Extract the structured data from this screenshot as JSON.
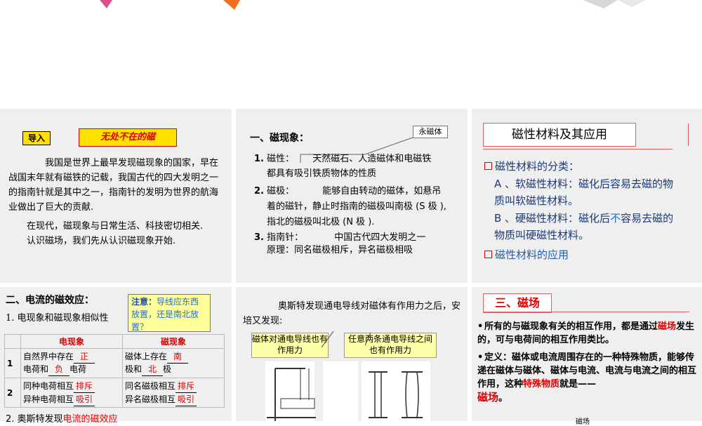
{
  "panel1": {
    "tag": "导入",
    "title": "无处不在的磁",
    "para1": "我国是世界上最早发现磁现象的国家，早在战国末年就有磁铁的记载，我国古代的四大发明之一的指南针就是其中之一，指南针的发明为世界的航海业做出了巨大的贡献.",
    "para2": "在现代，磁现象与日常生活、科技密切相关.",
    "para3": "认识磁场，我们先从认识磁现象开始."
  },
  "panel2": {
    "heading": "一、磁现象：",
    "callout": "永磁体",
    "item1_num": "1.",
    "item1_label": "磁性：",
    "item1_text": "天然磁石、人造磁体和电磁铁",
    "item1_cont": "都具有吸引铁质物体的性质",
    "item2_num": "2.",
    "item2_label": "磁极：",
    "item2_text": "能够自由转动的磁体，如悬吊",
    "item2_cont1": "着的磁针，静止时指南的磁极叫南极 (S 极 ),",
    "item2_cont2": "指北的磁极叫北极 (N 极 ).",
    "item3_num": "3.",
    "item3_label": "指南针：",
    "item3_text": "中国古代四大发明之一",
    "item3_cont": "原理：同名磁极相斥，异名磁极相吸"
  },
  "panel3": {
    "title": "磁性材料及其应用",
    "cat_label": "磁性材料的分类：",
    "a_line1": "A 、软磁性材料：磁化后容易去磁的物",
    "a_line2": "质叫软磁性材料。",
    "b_line1_pre": "B 、硬磁性材料：磁化后",
    "b_line1_hl": "不",
    "b_line1_post": "容易去磁的",
    "b_line2": "物质叫硬磁性材料。",
    "app_label": "磁性材料的应用"
  },
  "panel4": {
    "heading": "二、电流的磁效应：",
    "note_prefix": "注意：",
    "note_text": "导线应东西放置，还是南北放置？",
    "sub1": "1. 电现象和磁现象相似性",
    "col_elec": "电现象",
    "col_mag": "磁现象",
    "row1_num": "1",
    "row1_e_pre": "自然界中存在",
    "row1_e_blank1": "正",
    "row1_e_mid": "电荷和",
    "row1_e_blank2": "负",
    "row1_e_post": "电荷",
    "row1_m_pre": "磁体上存在",
    "row1_m_blank1": "南",
    "row1_m_mid": "极和",
    "row1_m_blank2": "北",
    "row1_m_post": "极",
    "row2_num": "2",
    "row2_e1_pre": "同种电荷相互",
    "row2_e1_blank": "排斥",
    "row2_e2_pre": "异种电荷相互",
    "row2_e2_blank": "吸引",
    "row2_m1_pre": "同名磁极相互",
    "row2_m1_blank": "排斥",
    "row2_m2_pre": "异名磁极相互",
    "row2_m2_blank": "吸引",
    "sub2_pre": "2. 奥斯特发现",
    "sub2_hl": "电流的磁效应"
  },
  "panel5": {
    "intro": "奥斯特发现通电导线对磁体有作用力之后，安培又发现:",
    "callout1": "磁体对通电导线也有作用力",
    "callout2": "任意两条通电导线之间也有作用力"
  },
  "panel6": {
    "title": "三、磁场",
    "b1_pre": "所有的与磁现象有关的相互作用，都是通过",
    "b1_hl": "磁场",
    "b1_post": "发生的，可与电荷间的相互作用类比。",
    "b2_label": "定义：",
    "b2_text": "磁体或电流周围存在的一种特殊物质，能够传递在磁体与磁体、磁体与电流、电流与电流之间的相互作用，这种",
    "b2_hl": "特殊物质",
    "b2_post": "就是——",
    "b2_final": "磁场",
    "b2_dot": "。",
    "footer_fragment": "磁场"
  },
  "colors": {
    "panel_bg": "#efefef",
    "highlight_yellow": "#ffe000",
    "accent_red": "#e00000",
    "accent_blue": "#1f6fd0"
  }
}
